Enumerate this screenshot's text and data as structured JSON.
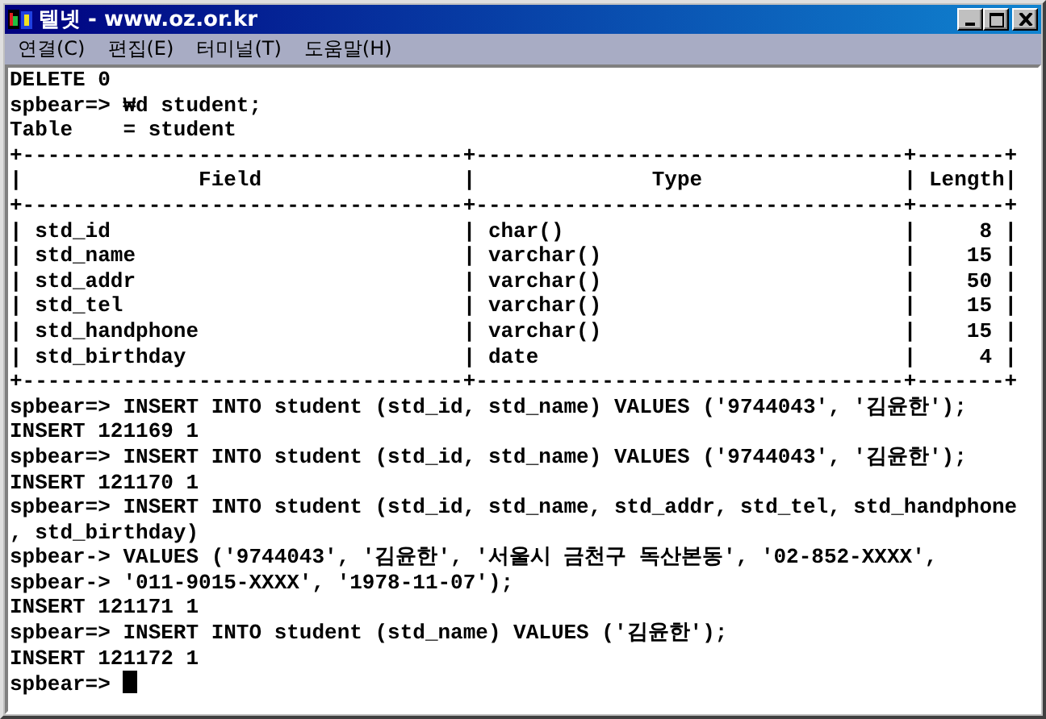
{
  "window": {
    "title": "텔넷 - www.oz.or.kr"
  },
  "menu": [
    "연결(C)",
    "편집(E)",
    "터미널(T)",
    "도움말(H)"
  ],
  "terminal": {
    "lines": [
      "DELETE 0",
      "spbear=> ₩d student;",
      "Table    = student",
      "+-----------------------------------+----------------------------------+-------+",
      "|              Field                |              Type                | Length|",
      "+-----------------------------------+----------------------------------+-------+",
      "| std_id                            | char()                           |     8 |",
      "| std_name                          | varchar()                        |    15 |",
      "| std_addr                          | varchar()                        |    50 |",
      "| std_tel                           | varchar()                        |    15 |",
      "| std_handphone                     | varchar()                        |    15 |",
      "| std_birthday                      | date                             |     4 |",
      "+-----------------------------------+----------------------------------+-------+",
      "spbear=> INSERT INTO student (std_id, std_name) VALUES ('9744043', '김윤한');",
      "INSERT 121169 1",
      "spbear=> INSERT INTO student (std_id, std_name) VALUES ('9744043', '김윤한');",
      "INSERT 121170 1",
      "spbear=> INSERT INTO student (std_id, std_name, std_addr, std_tel, std_handphone",
      ", std_birthday)",
      "spbear-> VALUES ('9744043', '김윤한', '서울시 금천구 독산본동', '02-852-XXXX',",
      "spbear-> '011-9015-XXXX', '1978-11-07');",
      "INSERT 121171 1",
      "spbear=> INSERT INTO student (std_name) VALUES ('김윤한');",
      "INSERT 121172 1",
      "spbear=>"
    ]
  }
}
